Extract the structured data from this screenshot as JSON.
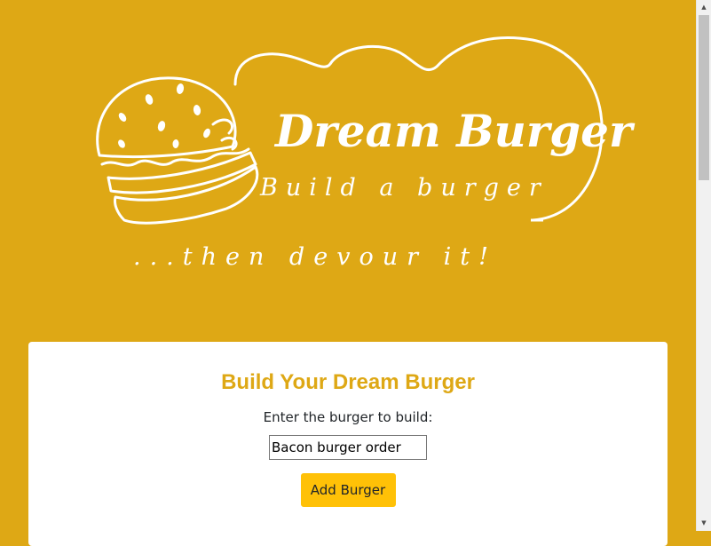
{
  "logo": {
    "title": "Dream Burger",
    "subtitle": "Build a burger",
    "tagline": "...then devour it!"
  },
  "form": {
    "heading": "Build Your Dream Burger",
    "label": "Enter the burger to build:",
    "input_value": "Bacon burger order",
    "button_label": "Add Burger"
  },
  "scrollbar": {
    "up_icon": "chevron-up-icon",
    "down_icon": "chevron-down-icon"
  },
  "colors": {
    "background": "#dea815",
    "heading": "#dea815",
    "button": "#ffc107",
    "card": "#ffffff"
  }
}
